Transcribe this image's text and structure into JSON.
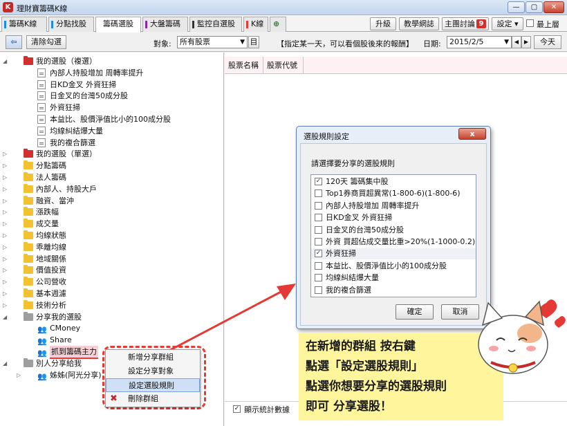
{
  "window": {
    "title": "理財寶籌碼K線",
    "min": "—",
    "max": "▢",
    "close": "✕"
  },
  "tabs": [
    {
      "label": "籌碼K線",
      "color": "#1e88e5"
    },
    {
      "label": "分點找股",
      "color": "#1e88e5"
    },
    {
      "label": "籌碼選股",
      "color": "#1e88e5"
    },
    {
      "label": "大盤籌碼",
      "color": "#8e24aa"
    },
    {
      "label": "監控自選股",
      "color": "#333333"
    },
    {
      "label": "K線",
      "color": "#e53935"
    }
  ],
  "top_buttons": {
    "upgrade": "升級",
    "teaching": "教學網誌",
    "forum": "主團討論",
    "forum_badge": "9",
    "settings": "設定",
    "topmost": "最上層"
  },
  "toolbar": {
    "clear": "清除勾選",
    "target_label": "對象:",
    "target_value": "所有股票",
    "target_btn": "目",
    "hint": "【指定某一天，可以看個股後來的報酬】",
    "date_label": "日期:",
    "date_value": "2015/2/5",
    "today": "今天"
  },
  "tree": [
    {
      "label": "我的選股（複選）",
      "type": "folder-red",
      "indent": 0,
      "arrow": "open"
    },
    {
      "label": "內部人持股增加 周轉率提升",
      "type": "file",
      "indent": 1
    },
    {
      "label": "日KD金叉 外資狂掃",
      "type": "file",
      "indent": 1
    },
    {
      "label": "日金叉的台灣50成分股",
      "type": "file",
      "indent": 1
    },
    {
      "label": "外資狂掃",
      "type": "file",
      "indent": 1
    },
    {
      "label": "本益比、股價淨值比小的100成分股",
      "type": "file",
      "indent": 1
    },
    {
      "label": "均線糾結爆大量",
      "type": "file",
      "indent": 1
    },
    {
      "label": "我的複合篩選",
      "type": "file",
      "indent": 1
    },
    {
      "label": "我的選股（單選）",
      "type": "folder-red",
      "indent": 0,
      "arrow": "closed"
    },
    {
      "label": "分點籌碼",
      "type": "folder",
      "indent": 0,
      "arrow": "closed"
    },
    {
      "label": "法人籌碼",
      "type": "folder",
      "indent": 0,
      "arrow": "closed"
    },
    {
      "label": "內部人、持股大戶",
      "type": "folder",
      "indent": 0,
      "arrow": "closed"
    },
    {
      "label": "融資、當沖",
      "type": "folder",
      "indent": 0,
      "arrow": "closed"
    },
    {
      "label": "漲跌幅",
      "type": "folder",
      "indent": 0,
      "arrow": "closed"
    },
    {
      "label": "成交量",
      "type": "folder",
      "indent": 0,
      "arrow": "closed"
    },
    {
      "label": "均線狀態",
      "type": "folder",
      "indent": 0,
      "arrow": "closed"
    },
    {
      "label": "乖離均線",
      "type": "folder",
      "indent": 0,
      "arrow": "closed"
    },
    {
      "label": "地域關係",
      "type": "folder",
      "indent": 0,
      "arrow": "closed"
    },
    {
      "label": "價值投資",
      "type": "folder",
      "indent": 0,
      "arrow": "closed"
    },
    {
      "label": "公司營收",
      "type": "folder",
      "indent": 0,
      "arrow": "closed"
    },
    {
      "label": "基本週濾",
      "type": "folder",
      "indent": 0,
      "arrow": "closed"
    },
    {
      "label": "技術分析",
      "type": "folder",
      "indent": 0,
      "arrow": "closed"
    },
    {
      "label": "分享我的選股",
      "type": "folder-share",
      "indent": 0,
      "arrow": "open"
    },
    {
      "label": "CMoney",
      "type": "user",
      "indent": 1
    },
    {
      "label": "Share",
      "type": "user",
      "indent": 1
    },
    {
      "label": "抓到籌碼主力",
      "type": "user",
      "indent": 1,
      "selected": true
    },
    {
      "label": "別人分享給我",
      "type": "folder-share",
      "indent": 0,
      "arrow": "open"
    },
    {
      "label": "姊姊(阿光分享)",
      "type": "user",
      "indent": 1,
      "arrow": "closed"
    }
  ],
  "grid": {
    "columns": [
      "股票名稱",
      "股票代號"
    ]
  },
  "dialog": {
    "title": "選股規則設定",
    "close": "x",
    "prompt": "請選擇要分享的選股規則",
    "rules": [
      {
        "label": "120天 籌碼集中股",
        "checked": true
      },
      {
        "label": "Top1券商買超異常(1-800-6)(1-800-6)",
        "checked": false
      },
      {
        "label": "內部人持股增加 周轉率提升",
        "checked": false
      },
      {
        "label": "日KD金叉 外資狂掃",
        "checked": false
      },
      {
        "label": "日金叉的台灣50成分股",
        "checked": false
      },
      {
        "label": "外資 買超佔成交量比重>20%(1-1000-0.2)",
        "checked": false
      },
      {
        "label": "外資狂掃",
        "checked": true
      },
      {
        "label": "本益比、股價淨值比小的100成分股",
        "checked": false
      },
      {
        "label": "均線糾結爆大量",
        "checked": false
      },
      {
        "label": "我的複合篩選",
        "checked": false
      }
    ],
    "ok": "確定",
    "cancel": "取消"
  },
  "context_menu": {
    "items": [
      "新增分享群組",
      "設定分享對象",
      "設定選股規則",
      "刪除群組"
    ],
    "highlighted": "設定選股規則"
  },
  "callout": {
    "lines": [
      "在新增的群組 按右鍵",
      "點選「設定選股規則」",
      "點選你想要分享的選股規則",
      "即可 分享選股！"
    ]
  },
  "bottom": {
    "show_stats": "顯示統計數據"
  }
}
